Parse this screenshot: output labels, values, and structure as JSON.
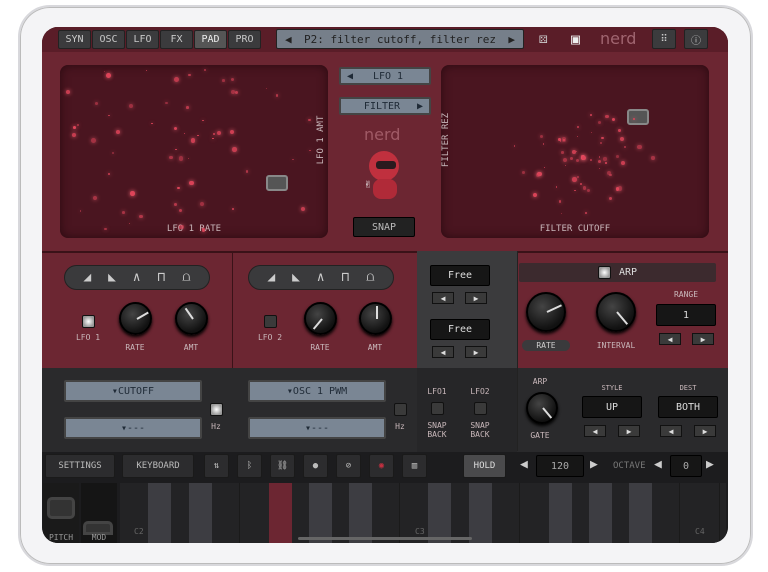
{
  "top_tabs": [
    "SYN",
    "OSC",
    "LFO",
    "FX",
    "PAD",
    "PRO"
  ],
  "active_tab": "PAD",
  "preset": "P2: filter cutoff, filter rez",
  "brand": "nerd",
  "pads": {
    "left_x": "LFO 1 RATE",
    "left_y": "LFO 1 AMT",
    "right_x": "FILTER CUTOFF",
    "right_y": "FILTER REZ",
    "source": "LFO 1",
    "dest": "FILTER",
    "snap": "SNAP"
  },
  "lfo1": {
    "label": "LFO 1",
    "rate": "RATE",
    "amt": "AMT",
    "dest": "CUTOFF",
    "dest2": "---",
    "hz": "Hz",
    "on": true
  },
  "lfo2": {
    "label": "LFO 2",
    "rate": "RATE",
    "amt": "AMT",
    "dest": "OSC 1 PWM",
    "dest2": "---",
    "hz": "Hz",
    "on": false
  },
  "sync": {
    "mode1": "Free",
    "mode2": "Free",
    "lfo1": "LFO1",
    "lfo2": "LFO2",
    "snap_back": "SNAP BACK"
  },
  "arp": {
    "title": "ARP",
    "rate": "RATE",
    "interval": "INTERVAL",
    "range_label": "RANGE",
    "range": "1",
    "gate_top": "ARP",
    "gate": "GATE",
    "style_label": "STYLE",
    "style": "UP",
    "dest_label": "DEST",
    "dest": "BOTH"
  },
  "toolbar": {
    "settings": "SETTINGS",
    "keyboard": "KEYBOARD",
    "hold": "HOLD",
    "tempo": "120",
    "octave_label": "OCTAVE",
    "octave": "0"
  },
  "keyboard": {
    "pitch": "PITCH",
    "mod": "MOD",
    "c2": "C2",
    "c3": "C3",
    "c4": "C4"
  },
  "colors": {
    "panel": "#6c2632",
    "accent": "#e0455a"
  }
}
